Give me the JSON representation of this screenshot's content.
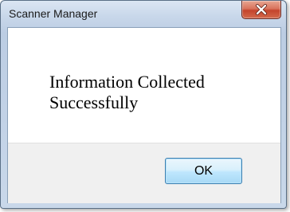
{
  "window": {
    "title": "Scanner Manager"
  },
  "dialog": {
    "message_line1": "Information Collected",
    "message_line2": "Successfully",
    "ok_label": "OK"
  },
  "icons": {
    "close": "close-icon"
  },
  "colors": {
    "close_button": "#c4442c",
    "ok_button_border": "#3c7fb1",
    "frame": "#c8d7ea"
  }
}
